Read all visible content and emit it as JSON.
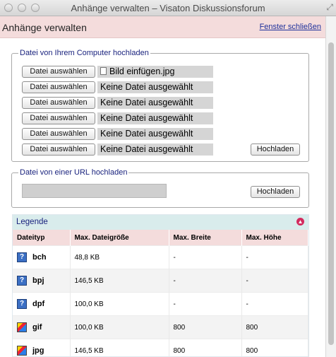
{
  "window": {
    "title": "Anhänge verwalten – Visaton Diskussionsforum"
  },
  "header": {
    "title": "Anhänge verwalten",
    "close_link": "Fenster schließen"
  },
  "upload_computer": {
    "legend": "Datei von Ihrem Computer hochladen",
    "choose_label": "Datei auswählen",
    "files": [
      "Bild einfügen.jpg",
      "Keine Datei ausgewählt",
      "Keine Datei ausgewählt",
      "Keine Datei ausgewählt",
      "Keine Datei ausgewählt",
      "Keine Datei ausgewählt"
    ],
    "upload_label": "Hochladen"
  },
  "upload_url": {
    "legend": "Datei von einer URL hochladen",
    "upload_label": "Hochladen"
  },
  "legend_panel": {
    "title": "Legende",
    "columns": [
      "Dateityp",
      "Max. Dateigröße",
      "Max. Breite",
      "Max. Höhe"
    ],
    "rows": [
      {
        "icon": "unknown-file-icon",
        "type": "bch",
        "size": "48,8 KB",
        "width": "-",
        "height": "-"
      },
      {
        "icon": "unknown-file-icon",
        "type": "bpj",
        "size": "146,5 KB",
        "width": "-",
        "height": "-"
      },
      {
        "icon": "unknown-file-icon",
        "type": "dpf",
        "size": "100,0 KB",
        "width": "-",
        "height": "-"
      },
      {
        "icon": "image-file-icon",
        "type": "gif",
        "size": "100,0 KB",
        "width": "800",
        "height": "800"
      },
      {
        "icon": "image-file-icon",
        "type": "jpg",
        "size": "146,5 KB",
        "width": "800",
        "height": "800"
      }
    ]
  }
}
